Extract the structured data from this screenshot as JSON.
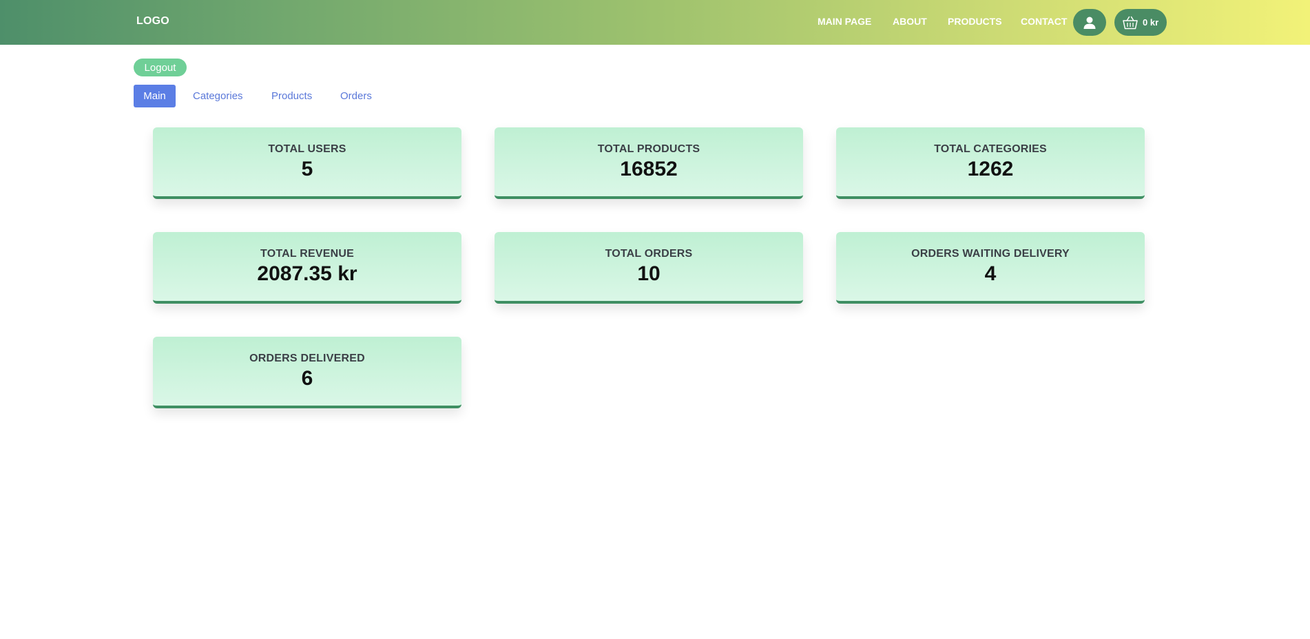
{
  "header": {
    "logo": "LOGO",
    "nav": [
      "MAIN PAGE",
      "ABOUT",
      "PRODUCTS",
      "CONTACT"
    ],
    "user_icon": "user-icon",
    "cart_icon": "basket-icon",
    "cart_total": "0 kr"
  },
  "admin": {
    "logout_label": "Logout",
    "tabs": [
      "Main",
      "Categories",
      "Products",
      "Orders"
    ],
    "active_tab": "Main"
  },
  "stats": [
    {
      "label": "TOTAL USERS",
      "value": "5"
    },
    {
      "label": "TOTAL PRODUCTS",
      "value": "16852"
    },
    {
      "label": "TOTAL CATEGORIES",
      "value": "1262"
    },
    {
      "label": "TOTAL REVENUE",
      "value": "2087.35 kr"
    },
    {
      "label": "TOTAL ORDERS",
      "value": "10"
    },
    {
      "label": "ORDERS WAITING DELIVERY",
      "value": "4"
    },
    {
      "label": "ORDERS DELIVERED",
      "value": "6"
    }
  ],
  "colors": {
    "header_gradient_start": "#4e8f6a",
    "header_gradient_end": "#f2f278",
    "accent_green": "#4a8c64",
    "logout_green": "#6fcf97",
    "active_tab_blue": "#5b7ee5",
    "link_blue": "#5a78d9",
    "card_border": "#3f8f63"
  }
}
